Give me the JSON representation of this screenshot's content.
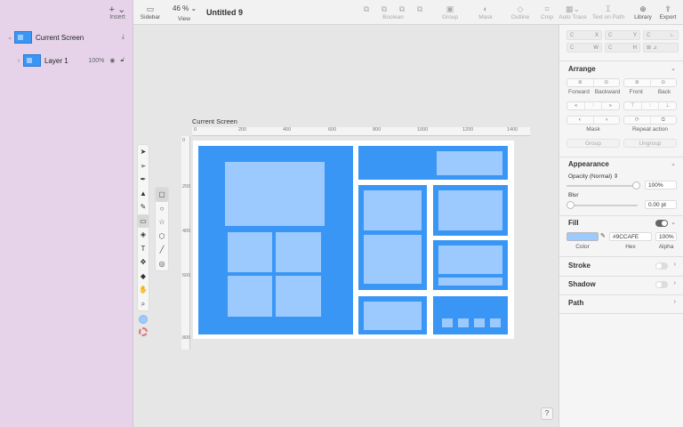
{
  "sidebar": {
    "insert_label": "Insert",
    "layers": [
      {
        "name": "Current Screen",
        "chevron": "⌄"
      },
      {
        "name": "Layer 1",
        "chevron": "›",
        "opacity": "100%"
      }
    ]
  },
  "toolbar": {
    "sidebar_label": "Sidebar",
    "zoom_value": "46 %",
    "view_label": "View",
    "doc_title": "Untitled 9",
    "boolean_label": "Boolean",
    "group_label": "Group",
    "mask_label": "Mask",
    "outline_label": "Outline",
    "crop_label": "Crop",
    "auto_trace_label": "Auto Trace",
    "text_on_path_label": "Text on Path",
    "library_label": "Library",
    "export_label": "Export"
  },
  "canvas": {
    "artboard_label": "Current Screen",
    "ruler_h": [
      "0",
      "200",
      "400",
      "600",
      "800",
      "1000",
      "1200",
      "1400"
    ],
    "ruler_v": [
      "0",
      "200",
      "400",
      "600",
      "800"
    ],
    "help_label": "?"
  },
  "colors": {
    "block": "#3A96F5",
    "light": "#9CCAFE"
  },
  "inspector": {
    "coords": [
      [
        {
          "ax": "X",
          "value": "C"
        },
        {
          "ax": "Y",
          "value": "C"
        },
        {
          "ax": "",
          "value": "C"
        }
      ],
      [
        {
          "ax": "W",
          "value": "C"
        },
        {
          "ax": "H",
          "value": "C"
        },
        {
          "ax": "",
          "value": ""
        }
      ]
    ],
    "arrange": {
      "title": "Arrange",
      "forward": "Forward",
      "backward": "Backward",
      "front": "Front",
      "back": "Back",
      "mask": "Mask",
      "repeat_action": "Repeat action",
      "group": "Group",
      "ungroup": "Ungroup"
    },
    "appearance": {
      "title": "Appearance",
      "opacity_label": "Opacity (Normal)",
      "opacity_value": "100%",
      "opacity_level": 1.0,
      "blur_label": "Blur",
      "blur_value": "0.00 pt",
      "blur_level": 0.0
    },
    "fill": {
      "title": "Fill",
      "hex": "#9CCAFE",
      "alpha": "100%",
      "color_label": "Color",
      "hex_label": "Hex",
      "alpha_label": "Alpha",
      "enabled": true
    },
    "stroke": {
      "title": "Stroke",
      "enabled": false
    },
    "shadow": {
      "title": "Shadow",
      "enabled": false
    },
    "path": {
      "title": "Path"
    }
  }
}
